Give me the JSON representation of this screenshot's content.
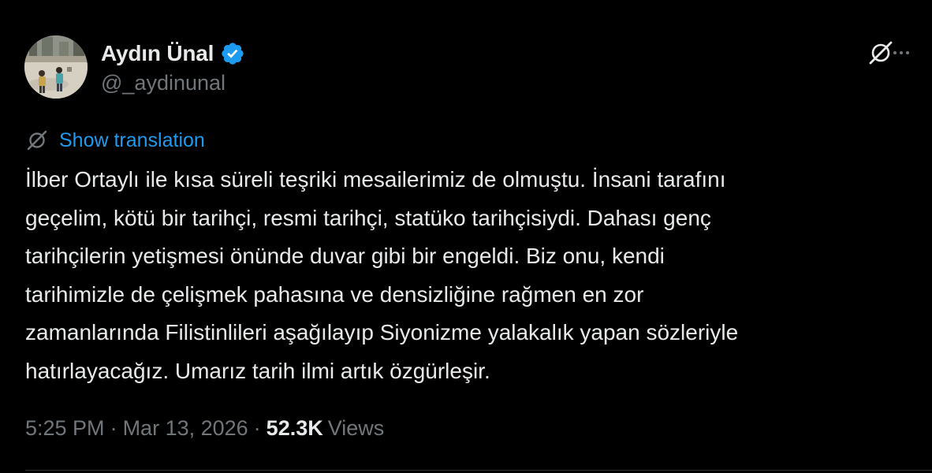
{
  "author": {
    "display_name": "Aydın Ünal",
    "handle": "@_aydinunal",
    "verified": true
  },
  "icons": {
    "avatar": "profile-photo",
    "verified": "verified-badge-icon",
    "grok": "grok-icon",
    "more": "more-options-icon",
    "translate": "translate-icon"
  },
  "colors": {
    "background": "#000000",
    "text": "#e7e9ea",
    "secondary_text": "#71767b",
    "link": "#1d9bf0",
    "verified_badge": "#1d9bf0"
  },
  "translation": {
    "label": "Show translation"
  },
  "tweet": {
    "lines": [
      "İlber Ortaylı ile kısa süreli teşriki mesailerimiz de olmuştu. İnsani tarafını",
      "geçelim, kötü bir tarihçi, resmi tarihçi, statüko tarihçisiydi. Dahası genç",
      "tarihçilerin yetişmesi önünde duvar gibi bir engeldi. Biz onu, kendi",
      "tarihimizle de çelişmek pahasına ve densizliğine rağmen en zor",
      "zamanlarında Filistinlileri aşağılayıp Siyonizme yalakalık yapan sözleriyle",
      "hatırlayacağız. Umarız tarih ilmi artık özgürleşir."
    ]
  },
  "meta": {
    "time": "5:25 PM",
    "date": "Mar 13, 2026",
    "separator": "·",
    "views_count": "52.3K",
    "views_label": "Views"
  }
}
